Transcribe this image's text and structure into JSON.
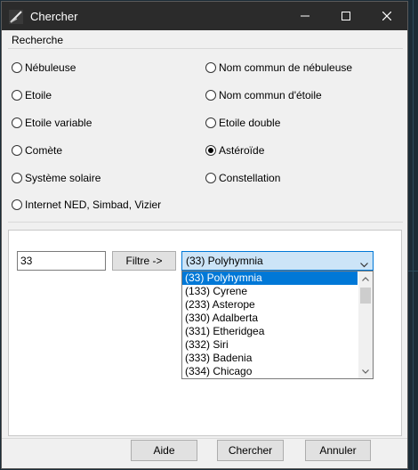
{
  "window": {
    "title": "Chercher",
    "icon": "app-icon",
    "controls": [
      "minimize-icon",
      "maximize-icon",
      "close-icon"
    ]
  },
  "search_group": {
    "label": "Recherche",
    "options": [
      {
        "label": "Nébuleuse",
        "checked": false
      },
      {
        "label": "Nom commun de nébuleuse",
        "checked": false
      },
      {
        "label": "Etoile",
        "checked": false
      },
      {
        "label": "Nom commun d'étoile",
        "checked": false
      },
      {
        "label": "Etoile variable",
        "checked": false
      },
      {
        "label": "Etoile double",
        "checked": false
      },
      {
        "label": "Comète",
        "checked": false
      },
      {
        "label": "Astéroïde",
        "checked": true
      },
      {
        "label": "Système solaire",
        "checked": false
      },
      {
        "label": "Constellation",
        "checked": false
      },
      {
        "label": "Internet NED, Simbad, Vizier",
        "checked": false
      }
    ]
  },
  "filter": {
    "input_value": "33",
    "button_label": "Filtre ->",
    "combo_value": "(33) Polyhymnia",
    "list_items": [
      "(33) Polyhymnia",
      "(133) Cyrene",
      "(233) Asterope",
      "(330) Adalberta",
      "(331) Etheridgea",
      "(332) Siri",
      "(333) Badenia",
      "(334) Chicago"
    ],
    "selected_index": 0
  },
  "buttons": {
    "help": "Aide",
    "search": "Chercher",
    "cancel": "Annuler"
  },
  "colors": {
    "titlebar": "#2b2b2b",
    "selection": "#0078d7",
    "combo_bg": "#cce4f7"
  }
}
